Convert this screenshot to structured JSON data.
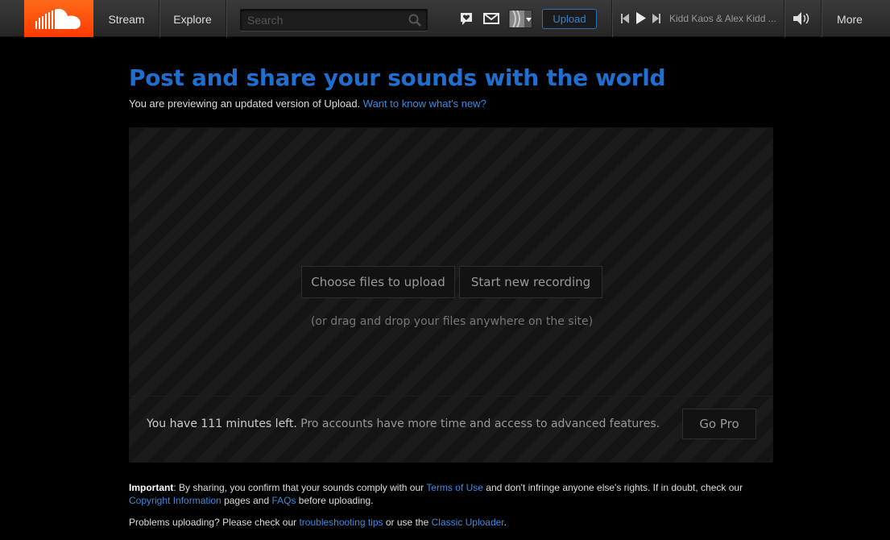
{
  "header": {
    "logo": "soundcloud-cloud-icon",
    "nav": [
      {
        "label": "Stream"
      },
      {
        "label": "Explore"
      }
    ],
    "search": {
      "placeholder": "Search",
      "value": ""
    },
    "upload_label": "Upload",
    "player": {
      "track_title": "Kidd Kaos & Alex Kidd ..."
    },
    "more_label": "More"
  },
  "main": {
    "title": "Post and share your sounds with the world",
    "subtitle_text": "You are previewing an updated version of Upload. ",
    "subtitle_link": "Want to know what's new?",
    "choose_files_label": "Choose files to upload",
    "start_recording_label": "Start new recording",
    "drag_hint": "(or drag and drop your files anywhere on the site)",
    "minutes_strong": "You have 111 minutes left.",
    "minutes_rest": " Pro accounts have more time and access to advanced features.",
    "go_pro_label": "Go Pro"
  },
  "notes": {
    "important_label": "Important",
    "p1_a": ": By sharing, you confirm that your sounds comply with our ",
    "terms_link": "Terms of Use",
    "p1_b": " and don't infringe anyone else's rights. If in doubt, check our ",
    "copyright_link": "Copyright Information",
    "p1_c": " pages and ",
    "faqs_link": "FAQs",
    "p1_d": " before uploading.",
    "p2_a": "Problems uploading? Please check our ",
    "troubleshooting_link": "troubleshooting tips",
    "p2_b": " or use the ",
    "classic_link": "Classic Uploader",
    "p2_c": "."
  },
  "colors": {
    "brand_orange": "#ff5500",
    "link_blue": "#3b8be0",
    "title_blue": "#1e6fd0"
  }
}
